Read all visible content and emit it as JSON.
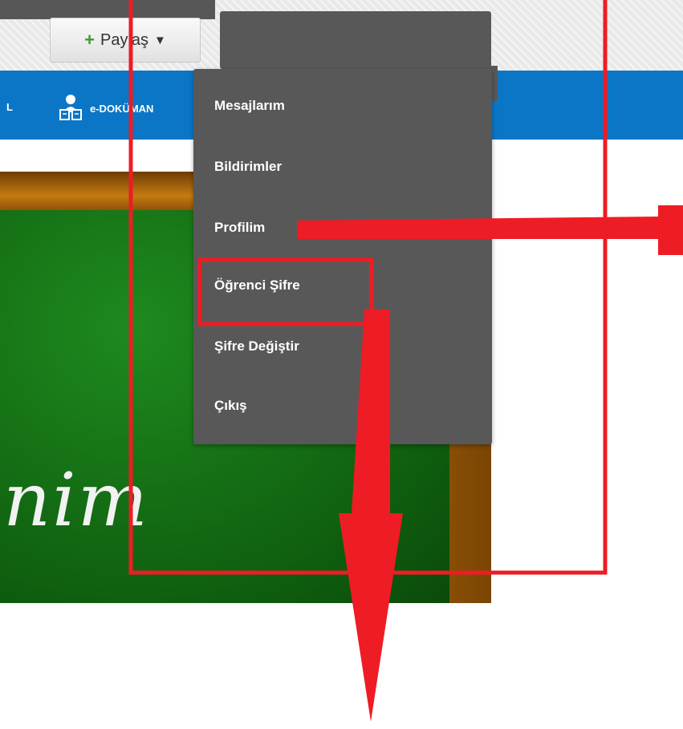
{
  "toolbar": {
    "share_label": "Paylaş",
    "share_plus": "+",
    "share_caret": "▼"
  },
  "navbar": {
    "truncated_item": "L",
    "document_item": "e-DOKÜMAN"
  },
  "user_menu": {
    "items": [
      {
        "label": "Mesajlarım"
      },
      {
        "label": "Bildirimler"
      },
      {
        "label": "Profilim"
      },
      {
        "label": "Öğrenci Şifre"
      },
      {
        "label": "Şifre Değiştir"
      },
      {
        "label": "Çıkış"
      }
    ]
  },
  "banner": {
    "chalk_text": "nim"
  },
  "colors": {
    "navbar": "#0b76c6",
    "menu_background": "#585858",
    "annotation_red": "#ee1c24",
    "chalkboard_green": "#1e8a1e"
  },
  "icons": [
    "plus-icon",
    "caret-down-icon",
    "document-users-icon"
  ]
}
